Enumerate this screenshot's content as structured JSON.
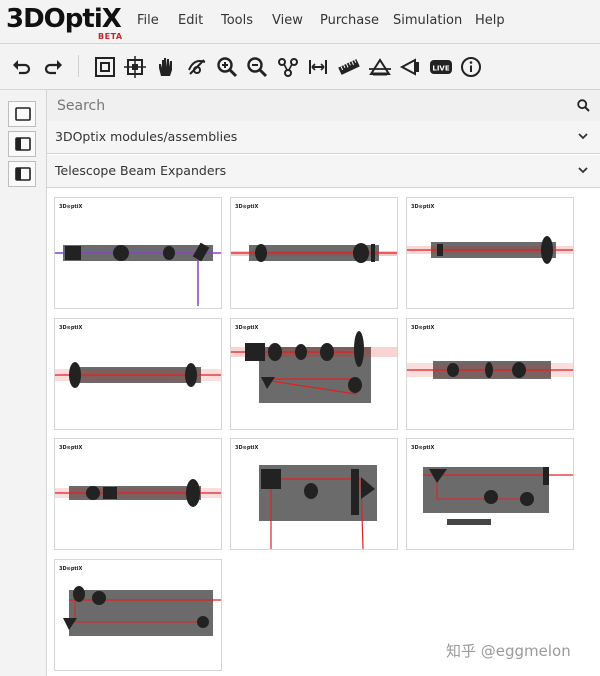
{
  "app": {
    "logo_text": "3DOptiX",
    "logo_badge": "BETA"
  },
  "menu": [
    "File",
    "Edit",
    "Tools",
    "View",
    "Purchase",
    "Simulation",
    "Help"
  ],
  "toolbar": {
    "icons": [
      "undo-icon",
      "redo-icon",
      "fit-view-icon",
      "select-region-icon",
      "pan-hand-icon",
      "rotate-icon",
      "zoom-in-icon",
      "zoom-out-icon",
      "group-icon",
      "measure-distance-icon",
      "ruler-icon",
      "optical-bench-icon",
      "laser-source-icon",
      "live-icon",
      "info-icon"
    ],
    "live_label": "LIVE"
  },
  "search": {
    "placeholder": "Search"
  },
  "sections": [
    {
      "label": "3DOptix modules/assemblies"
    },
    {
      "label": "Telescope Beam Expanders"
    }
  ],
  "thumbnails": [
    {
      "logo": "3D⊙ptiX",
      "name": "beam-expander-1"
    },
    {
      "logo": "3D⊙ptiX",
      "name": "beam-expander-2"
    },
    {
      "logo": "3D⊙ptiX",
      "name": "beam-expander-3"
    },
    {
      "logo": "3D⊙ptiX",
      "name": "beam-expander-4"
    },
    {
      "logo": "3D⊙ptiX",
      "name": "beam-expander-5"
    },
    {
      "logo": "3D⊙ptiX",
      "name": "beam-expander-6"
    },
    {
      "logo": "3D⊙ptiX",
      "name": "beam-expander-7"
    },
    {
      "logo": "3D⊙ptiX",
      "name": "beam-expander-8"
    },
    {
      "logo": "3D⊙ptiX",
      "name": "beam-expander-9"
    },
    {
      "logo": "3D⊙ptiX",
      "name": "beam-expander-10"
    }
  ],
  "watermark": "知乎 @eggmelon",
  "colors": {
    "accent_red": "#c0282d",
    "beam_red": "#e02020",
    "beam_purple": "#8a3fd0",
    "breadboard": "#6b6b6b"
  }
}
